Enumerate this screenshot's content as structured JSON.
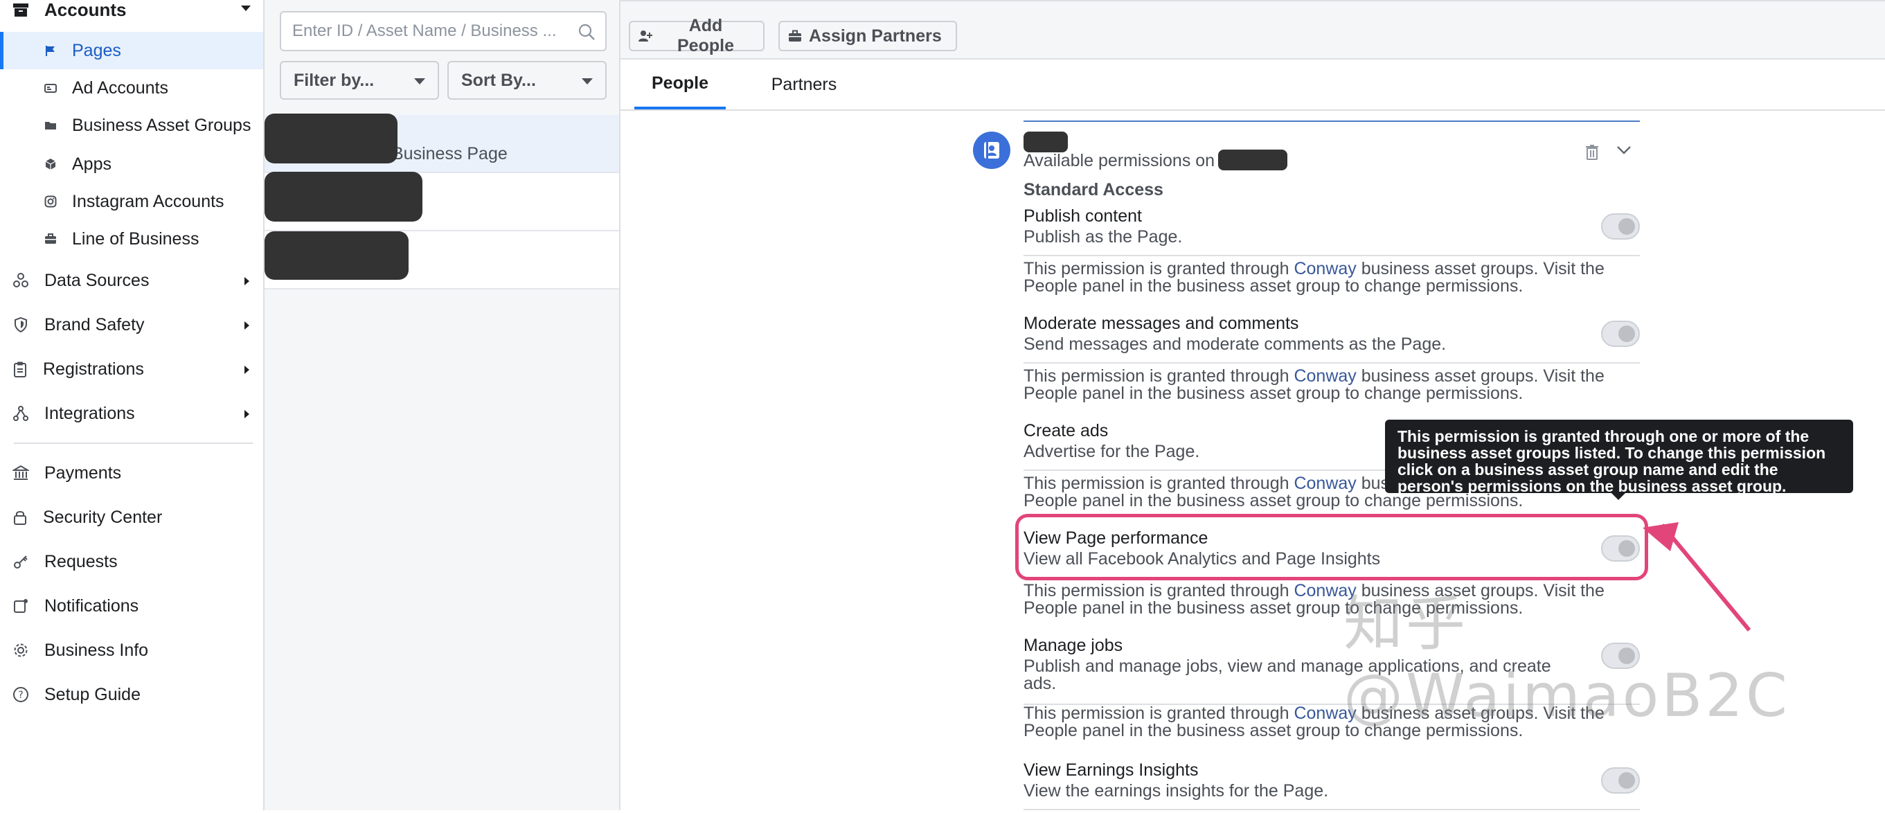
{
  "sidebar": {
    "accounts_label": "Accounts",
    "sub_items": [
      {
        "label": "Pages",
        "icon": "flag-icon",
        "active": true
      },
      {
        "label": "Ad Accounts",
        "icon": "ad-accounts-icon"
      },
      {
        "label": "Business Asset Groups",
        "icon": "folder-icon"
      },
      {
        "label": "Apps",
        "icon": "cube-icon"
      },
      {
        "label": "Instagram Accounts",
        "icon": "instagram-icon"
      },
      {
        "label": "Line of Business",
        "icon": "briefcase-icon"
      }
    ],
    "sections": [
      {
        "label": "Data Sources",
        "icon": "data-sources-icon"
      },
      {
        "label": "Brand Safety",
        "icon": "shield-icon"
      },
      {
        "label": "Registrations",
        "icon": "clipboard-icon"
      },
      {
        "label": "Integrations",
        "icon": "integrations-icon"
      }
    ],
    "footer_items": [
      {
        "label": "Payments",
        "icon": "bank-icon"
      },
      {
        "label": "Security Center",
        "icon": "lock-icon"
      },
      {
        "label": "Requests",
        "icon": "key-icon"
      },
      {
        "label": "Notifications",
        "icon": "bell-icon"
      },
      {
        "label": "Business Info",
        "icon": "gear-icon"
      },
      {
        "label": "Setup Guide",
        "icon": "question-icon"
      }
    ]
  },
  "middle": {
    "search_placeholder": "Enter ID / Asset Name / Business ...",
    "filter_label": "Filter by...",
    "sort_label": "Sort By...",
    "list": [
      {
        "visible_text": "Business Page"
      },
      {
        "visible_text": ""
      },
      {
        "visible_text": ""
      }
    ]
  },
  "main": {
    "add_people_label": "Add People",
    "assign_partners_label": "Assign Partners",
    "tabs": [
      "People",
      "Partners"
    ],
    "available_permissions_label": "Available permissions on",
    "standard_access_label": "Standard Access",
    "note_before": "This permission is granted through ",
    "note_link": "Conway",
    "note_after": " business asset groups. Visit the People panel in the business asset group to change permissions.",
    "permissions": [
      {
        "title": "Publish content",
        "desc": "Publish as the Page."
      },
      {
        "title": "Moderate messages and comments",
        "desc": "Send messages and moderate comments as the Page."
      },
      {
        "title": "Create ads",
        "desc": "Advertise for the Page."
      },
      {
        "title": "View Page performance",
        "desc": "View all Facebook Analytics and Page Insights"
      },
      {
        "title": "Manage jobs",
        "desc": "Publish and manage jobs, view and manage applications, and create ads."
      },
      {
        "title": "View Earnings Insights",
        "desc": "View the earnings insights for the Page."
      }
    ],
    "tooltip_text": "This permission is granted through one or more of the business asset groups listed. To change this permission click on a business asset group name and edit the person's permissions on the business asset group.",
    "watermark": "知乎 @WaimaoB2C"
  },
  "colors": {
    "accent": "#1877f2",
    "highlight": "#e2457a",
    "tooltip_bg": "#1c1e21",
    "link": "#385898"
  }
}
